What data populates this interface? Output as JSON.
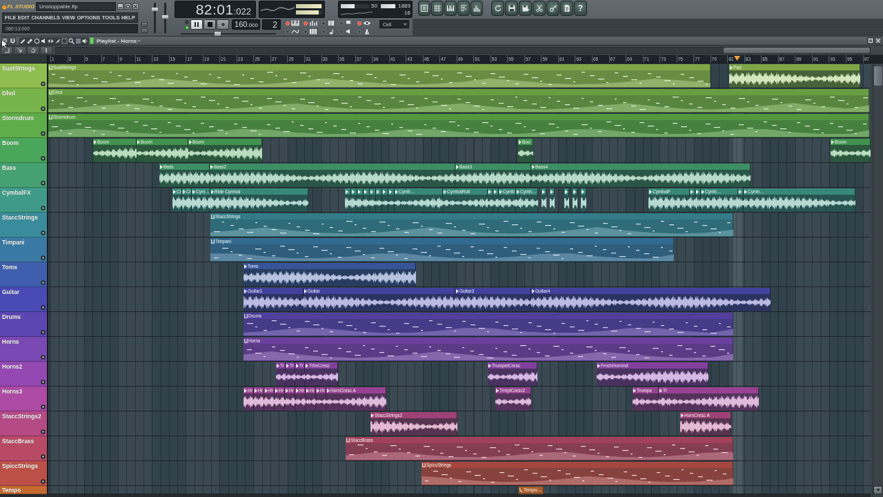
{
  "app": {
    "logo": "FL STUDIO",
    "file_name": "Unstoppable.flp"
  },
  "menu": [
    "FILE",
    "EDIT",
    "CHANNELS",
    "VIEW",
    "OPTIONS",
    "TOOLS",
    "HELP"
  ],
  "hint_bar": "060:13:000",
  "master_sliders": [
    {
      "level": 0.82
    },
    {
      "level": 0.55
    }
  ],
  "song_time": {
    "main": "82:01",
    "ticks": ":022"
  },
  "output_meters": [
    {
      "level": 0.95
    },
    {
      "level": 0.84
    }
  ],
  "cpu": {
    "level": 0.5,
    "reading": "50"
  },
  "memory": {
    "level": 0.95,
    "reading": "1889"
  },
  "polyphony": "16",
  "toolbar": {
    "help": "?"
  },
  "transport": {
    "song_mode": true,
    "tempo": "160",
    "tempo_fraction": ".000",
    "pattern": "2",
    "position": {
      "level": 0.38
    }
  },
  "record_options": [
    {
      "on": true
    },
    {
      "on": true
    },
    {
      "on": false
    },
    {
      "on": false
    },
    {
      "on": true
    },
    {
      "on": false
    },
    {
      "on": false
    },
    {
      "on": false
    },
    {
      "on": false
    },
    {
      "on": false
    }
  ],
  "snap": "Cell",
  "playlist": {
    "title": "Playlist - Horns",
    "ruler": [
      "1",
      "3",
      "5",
      "7",
      "9",
      "11",
      "13",
      "15",
      "17",
      "19",
      "21",
      "23",
      "25",
      "27",
      "29",
      "31",
      "33",
      "35",
      "37",
      "39",
      "41",
      "43",
      "45",
      "47",
      "49",
      "51",
      "53",
      "55",
      "57",
      "59",
      "61",
      "63",
      "65",
      "67",
      "69",
      "71",
      "73",
      "75",
      "77",
      "79",
      "81",
      "83",
      "85",
      "87",
      "89",
      "91",
      "93",
      "95",
      "97"
    ],
    "tracks": [
      {
        "name": "SustStrings",
        "color": "#8fbd4f",
        "clips": [
          {
            "name": "SustStrings",
            "kind": "pattern"
          },
          {
            "name": "Pad",
            "kind": "audio"
          }
        ]
      },
      {
        "name": "Dhol",
        "color": "#76b44a",
        "clips": [
          {
            "name": "Dhol",
            "kind": "pattern"
          }
        ]
      },
      {
        "name": "Stormdrum",
        "color": "#5ead4a",
        "clips": [
          {
            "name": "Stormdrum",
            "kind": "pattern"
          }
        ]
      },
      {
        "name": "Boom",
        "color": "#4aa65a",
        "clips": [
          {
            "name": "Boom",
            "kind": "audio"
          },
          {
            "name": "Boom",
            "kind": "audio"
          },
          {
            "name": "Boom",
            "kind": "audio"
          },
          {
            "name": "Boo",
            "kind": "audio"
          },
          {
            "name": "Boom",
            "kind": "audio"
          }
        ]
      },
      {
        "name": "Bass",
        "color": "#45a172",
        "clips": [
          {
            "name": "Bass",
            "kind": "audio"
          },
          {
            "name": "Bass2",
            "kind": "audio"
          },
          {
            "name": "Bass3",
            "kind": "audio"
          },
          {
            "name": "Bass4",
            "kind": "audio"
          }
        ]
      },
      {
        "name": "CymbalFX",
        "color": "#3f9b88",
        "clips": [
          {
            "name": "Cr",
            "kind": "audio"
          },
          {
            "name": "Cr",
            "kind": "audio"
          },
          {
            "name": "Cym…",
            "kind": "audio"
          },
          {
            "name": "Ride Cymbal",
            "kind": "audio"
          },
          {
            "kind": "audio"
          },
          {
            "kind": "audio"
          },
          {
            "kind": "audio"
          },
          {
            "kind": "audio"
          },
          {
            "kind": "audio"
          },
          {
            "kind": "audio"
          },
          {
            "kind": "audio"
          },
          {
            "kind": "audio"
          },
          {
            "name": "Cymb…",
            "kind": "audio"
          },
          {
            "name": "CymbalRoll",
            "kind": "audio"
          },
          {
            "kind": "audio"
          },
          {
            "kind": "audio"
          },
          {
            "name": "Cymb",
            "kind": "audio"
          },
          {
            "name": "Cymb…",
            "kind": "audio"
          },
          {
            "kind": "audio"
          },
          {
            "kind": "audio"
          },
          {
            "kind": "audio"
          },
          {
            "kind": "audio"
          },
          {
            "kind": "audio"
          },
          {
            "name": "CymbalF",
            "kind": "audio"
          },
          {
            "kind": "audio"
          },
          {
            "kind": "audio"
          },
          {
            "name": "Cymb…",
            "kind": "audio"
          },
          {
            "kind": "audio"
          },
          {
            "name": "Cymb…",
            "kind": "audio"
          }
        ]
      },
      {
        "name": "StaccStrings",
        "color": "#3a8c9c",
        "clips": [
          {
            "name": "StaccStrings",
            "kind": "pattern"
          }
        ]
      },
      {
        "name": "Timpani",
        "color": "#3a79a4",
        "clips": [
          {
            "name": "Timpani",
            "kind": "pattern"
          }
        ]
      },
      {
        "name": "Toms",
        "color": "#3f5fae",
        "clips": [
          {
            "name": "Toms",
            "kind": "audio"
          }
        ]
      },
      {
        "name": "Guitar",
        "color": "#4a4ab4",
        "clips": [
          {
            "name": "Guitar1",
            "kind": "audio"
          },
          {
            "name": "Guitar",
            "kind": "audio"
          },
          {
            "name": "Guitar3",
            "kind": "audio"
          },
          {
            "name": "Guitar4",
            "kind": "audio"
          }
        ]
      },
      {
        "name": "Drums",
        "color": "#5c46b2",
        "clips": [
          {
            "name": "Drums",
            "kind": "pattern"
          }
        ]
      },
      {
        "name": "Horns",
        "color": "#7a48b2",
        "clips": [
          {
            "name": "Horns",
            "kind": "pattern"
          }
        ]
      },
      {
        "name": "Horns2",
        "color": "#9448b2",
        "clips": [
          {
            "name": "Tr",
            "kind": "audio"
          },
          {
            "name": "Tr",
            "kind": "audio"
          },
          {
            "name": "Tr",
            "kind": "audio"
          },
          {
            "name": "TrbnCresc",
            "kind": "audio"
          },
          {
            "name": "TrumpetCresc",
            "kind": "audio"
          },
          {
            "name": "FrnchHornInd",
            "kind": "audio"
          }
        ]
      },
      {
        "name": "Horns3",
        "color": "#ac4aa4",
        "clips": [
          {
            "name": "Hr",
            "kind": "audio"
          },
          {
            "name": "Hr",
            "kind": "audio"
          },
          {
            "name": "Hr",
            "kind": "audio"
          },
          {
            "name": "Hr",
            "kind": "audio"
          },
          {
            "name": "Hr",
            "kind": "audio"
          },
          {
            "name": "Hr",
            "kind": "audio"
          },
          {
            "name": "Hr",
            "kind": "audio"
          },
          {
            "name": "Hr",
            "kind": "audio"
          },
          {
            "name": "HornCresc A",
            "kind": "audio"
          },
          {
            "name": "TrmptCresc2",
            "kind": "audio"
          },
          {
            "name": "Trumpe",
            "kind": "audio"
          },
          {
            "name": "Tr",
            "kind": "audio"
          }
        ]
      },
      {
        "name": "StaccStrings2",
        "color": "#b44a86",
        "clips": [
          {
            "name": "StaccStrings2",
            "kind": "audio"
          },
          {
            "name": "HornCresc A",
            "kind": "audio"
          }
        ]
      },
      {
        "name": "StaccBrass",
        "color": "#b84a66",
        "clips": [
          {
            "name": "StaccBrass",
            "kind": "pattern"
          }
        ]
      },
      {
        "name": "SpiccStrings",
        "color": "#bc5048",
        "clips": [
          {
            "name": "SpiccStrings",
            "kind": "pattern"
          }
        ]
      },
      {
        "name": "Tempo",
        "color": "#c46a30",
        "clips": [
          {
            "name": "Tempo…",
            "kind": "automation"
          }
        ]
      }
    ]
  }
}
